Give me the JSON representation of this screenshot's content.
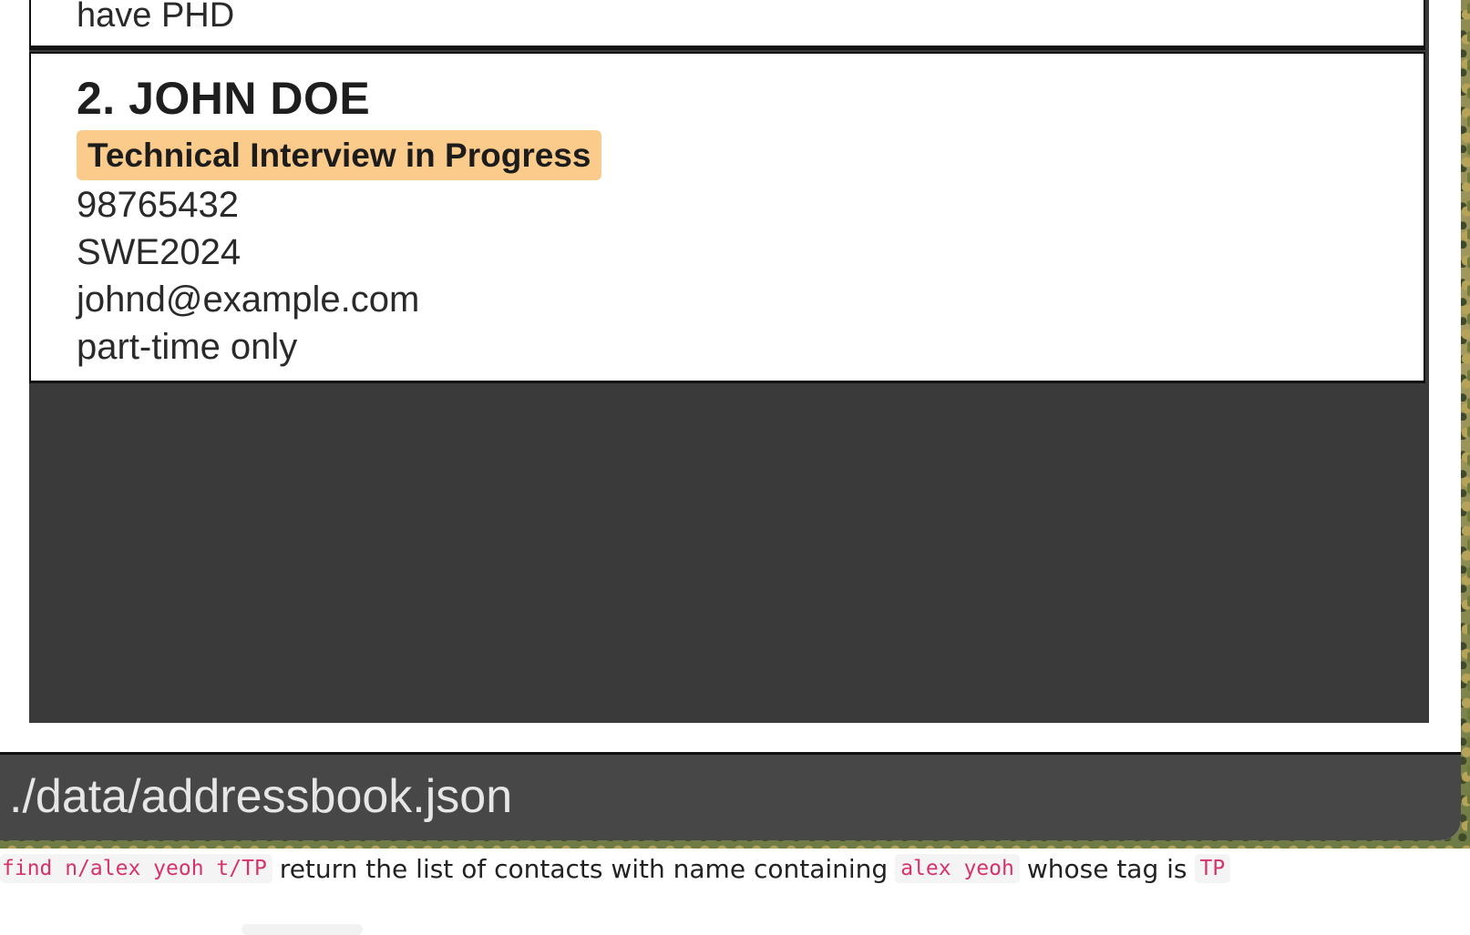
{
  "list": {
    "previous_card": {
      "remark": "have PHD"
    },
    "current_card": {
      "name": "2. JOHN DOE",
      "status": "Technical Interview in Progress",
      "phone": "98765432",
      "job_code": "SWE2024",
      "email": "johnd@example.com",
      "remark": "part-time only"
    }
  },
  "status_bar": {
    "file_path": "./data/addressbook.json"
  },
  "caption": {
    "command": "find n/alex yeoh t/TP",
    "text_1": "return the list of contacts with name containing",
    "name_value": "alex yeoh",
    "text_2": "whose tag is",
    "tag_value": "TP"
  },
  "colors": {
    "status_badge": "#fbcb8c",
    "list_background": "#3a3a3a",
    "status_bar_background": "#474747",
    "code_text": "#d6336c"
  }
}
